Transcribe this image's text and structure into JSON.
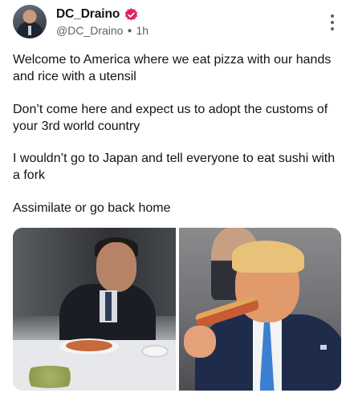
{
  "post": {
    "author": {
      "display_name": "DC_Draino",
      "handle": "@DC_Draino",
      "time": "1h",
      "verified_color": "#e0245e"
    },
    "more_icon": "more-vertical-icon",
    "paragraphs": [
      "Welcome to America where we eat pizza with our hands and rice with a utensil",
      "Don’t come here and expect us to adopt the customs of your 3rd world country",
      "I wouldn’t go to Japan and tell everyone to eat sushi with a fork",
      "Assimilate or go back home"
    ]
  }
}
